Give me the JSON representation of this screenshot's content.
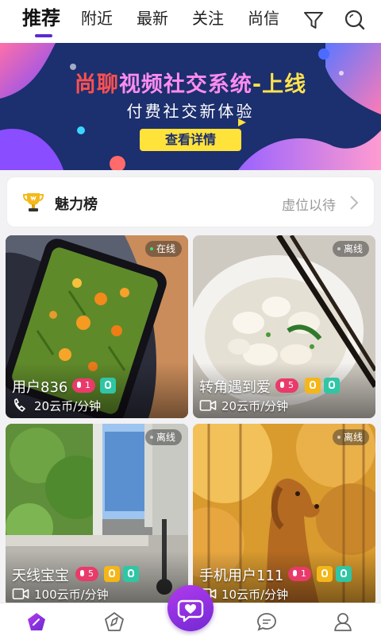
{
  "top_nav": {
    "tabs": [
      {
        "label": "推荐",
        "active": true
      },
      {
        "label": "附近",
        "active": false
      },
      {
        "label": "最新",
        "active": false
      },
      {
        "label": "关注",
        "active": false
      },
      {
        "label": "尚信",
        "active": false
      }
    ],
    "icons": [
      "filter-icon",
      "search-icon"
    ],
    "accent_color": "#5a2bd1"
  },
  "banner": {
    "title_part1": "尚聊",
    "title_part2": "视频社交系统",
    "title_part3": "-上线",
    "subtitle": "付费社交新体验",
    "button_label": "查看详情"
  },
  "ranking": {
    "title": "魅力榜",
    "right_text": "虚位以待",
    "icon": "trophy-icon"
  },
  "cards": [
    {
      "name": "用户836",
      "status": "在线",
      "level": "1",
      "price": "20云币/分钟",
      "call_type": "phone-icon"
    },
    {
      "name": "转角遇到爱",
      "status": "离线",
      "level": "5",
      "price": "20云币/分钟",
      "call_type": "video-icon"
    },
    {
      "name": "天线宝宝",
      "status": "离线",
      "level": "5",
      "price": "100云币/分钟",
      "call_type": "video-icon"
    },
    {
      "name": "手机用户111",
      "status": "离线",
      "level": "1",
      "price": "10云币/分钟",
      "call_type": "video-icon"
    }
  ],
  "bottom_nav": {
    "items": [
      "home-icon",
      "compass-icon",
      "heart-chat-icon",
      "message-icon",
      "profile-icon"
    ],
    "center_color": "#9a34e6"
  }
}
